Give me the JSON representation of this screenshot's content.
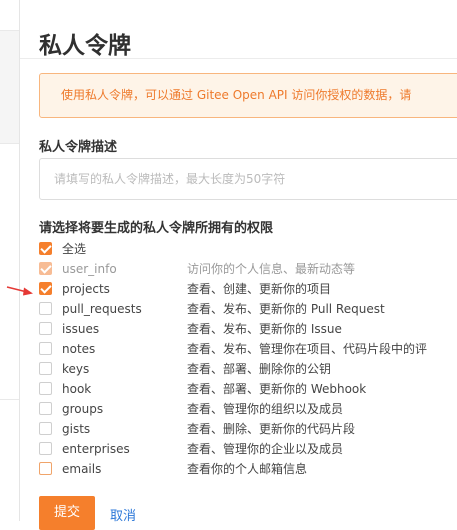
{
  "page": {
    "title": "私人令牌",
    "notice": "使用私人令牌，可以通过 Gitee Open API 访问你授权的数据，请"
  },
  "form": {
    "description_label": "私人令牌描述",
    "description_placeholder": "请填写的私人令牌描述，最大长度为50字符",
    "permissions_label": "请选择将要生成的私人令牌所拥有的权限",
    "select_all": {
      "label": "全选",
      "checked": true
    }
  },
  "permissions": [
    {
      "scope": "user_info",
      "description": "访问你的个人信息、最新动态等",
      "checked": true,
      "disabled": true
    },
    {
      "scope": "projects",
      "description": "查看、创建、更新你的项目",
      "checked": true,
      "disabled": false
    },
    {
      "scope": "pull_requests",
      "description": "查看、发布、更新你的 Pull Request",
      "checked": false,
      "disabled": false
    },
    {
      "scope": "issues",
      "description": "查看、发布、更新你的 Issue",
      "checked": false,
      "disabled": false
    },
    {
      "scope": "notes",
      "description": "查看、发布、管理你在项目、代码片段中的评",
      "checked": false,
      "disabled": false
    },
    {
      "scope": "keys",
      "description": "查看、部署、删除你的公钥",
      "checked": false,
      "disabled": false
    },
    {
      "scope": "hook",
      "description": "查看、部署、更新你的 Webhook",
      "checked": false,
      "disabled": false
    },
    {
      "scope": "groups",
      "description": "查看、管理你的组织以及成员",
      "checked": false,
      "disabled": false
    },
    {
      "scope": "gists",
      "description": "查看、删除、更新你的代码片段",
      "checked": false,
      "disabled": false
    },
    {
      "scope": "enterprises",
      "description": "查看、管理你的企业以及成员",
      "checked": false,
      "disabled": false
    },
    {
      "scope": "emails",
      "description": "查看你的个人邮箱信息",
      "checked": false,
      "disabled": false
    }
  ],
  "actions": {
    "submit_label": "提交",
    "cancel_label": "取消"
  },
  "colors": {
    "accent": "#f57f2c",
    "notice_bg": "#fef4e8",
    "notice_text": "#ee7a2c",
    "link": "#2b77d8",
    "annotation_arrow": "#e53935"
  },
  "annotation": {
    "icon": "red-arrow-icon",
    "points_to": "projects"
  }
}
